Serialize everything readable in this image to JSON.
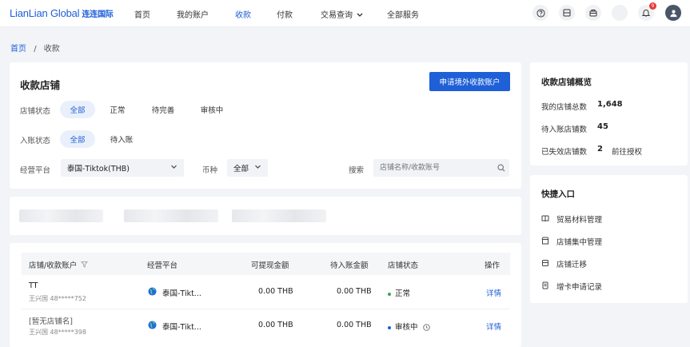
{
  "brand": {
    "logo_text": "LianLian Global",
    "logo_cn": "连连国际",
    "accent": "#1f5fd8"
  },
  "nav": [
    {
      "label": "首页"
    },
    {
      "label": "我的账户"
    },
    {
      "label": "收款"
    },
    {
      "label": "付款"
    },
    {
      "label": "交易查询"
    },
    {
      "label": "全部服务"
    }
  ],
  "header_icons": {
    "help": "help-circle-icon",
    "doc": "document-icon",
    "gift": "gift-icon",
    "bell_badge": "9",
    "avatar": "user-avatar-icon"
  },
  "breadcrumb": {
    "home": "首页",
    "sep": "/",
    "current": "收款"
  },
  "main": {
    "title": "收款店铺",
    "apply_button": "申请境外收款账户",
    "filter_store_status": {
      "label": "店铺状态",
      "options": [
        "全部",
        "正常",
        "待完善",
        "审核中"
      ]
    },
    "filter_arrival": {
      "label": "入账状态",
      "options": [
        "全部",
        "待入账"
      ]
    },
    "platform": {
      "label": "经营平台",
      "value": "泰国-Tiktok(THB)"
    },
    "currency": {
      "label": "币种",
      "value": "全部"
    },
    "search": {
      "label": "搜索",
      "placeholder": "店铺名称/收款账号"
    }
  },
  "table": {
    "headers": [
      "店铺/收款账户",
      "经营平台",
      "可提现金额",
      "待入账金额",
      "店铺状态",
      "操作"
    ],
    "rows": [
      {
        "name": "TT",
        "owner": "王兴国 48*****752",
        "platform": "泰国-Tikt...",
        "withdrawable": "0.00 THB",
        "pending": "0.00 THB",
        "status": "正常",
        "status_color": "#34a853",
        "action": "详情"
      },
      {
        "name": "[暂无店铺名]",
        "owner": "王兴国 48*****398",
        "platform": "泰国-Tikt...",
        "withdrawable": "0.00 THB",
        "pending": "0.00 THB",
        "status": "审核中",
        "status_color": "#1f5fd8",
        "action": "详情"
      }
    ]
  },
  "overview": {
    "title": "收款店铺概览",
    "items": [
      {
        "label": "我的店铺总数",
        "value": "1,648"
      },
      {
        "label": "待入账店铺数",
        "value": "45"
      },
      {
        "label": "已失效店铺数",
        "value": "2",
        "link": "前往授权"
      }
    ]
  },
  "quick": {
    "title": "快捷入口",
    "items": [
      {
        "label": "贸易材料管理",
        "icon": "book-icon"
      },
      {
        "label": "店铺集中管理",
        "icon": "store-icon"
      },
      {
        "label": "店铺迁移",
        "icon": "migrate-icon"
      },
      {
        "label": "增卡申请记录",
        "icon": "card-icon"
      }
    ]
  }
}
